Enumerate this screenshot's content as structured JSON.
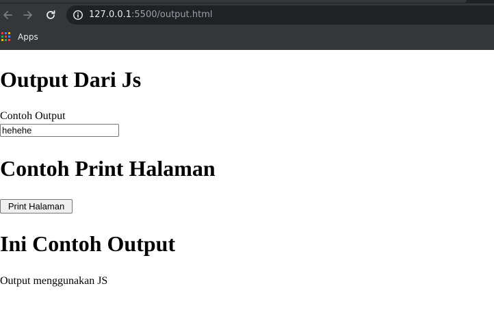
{
  "browser": {
    "url_host": "127.0.0.1",
    "url_path": ":5500/output.html",
    "bookmarks": [
      {
        "label": "Apps",
        "icon": "apps-grid-icon"
      }
    ],
    "icons": {
      "back": "back-arrow-icon",
      "forward": "forward-arrow-icon",
      "reload": "reload-icon",
      "site_info": "info-icon"
    }
  },
  "page": {
    "heading_output": "Output Dari Js",
    "contoh_label": "Contoh Output",
    "contoh_input_value": "hehehe",
    "heading_print": "Contoh Print Halaman",
    "print_button_label": "Print Halaman",
    "heading_ini": "Ini Contoh Output",
    "paragraph": "Output menggunakan JS"
  },
  "colors": {
    "chrome_bg": "#35363a",
    "omnibox_bg": "#202124",
    "chrome_text": "#e8eaed",
    "chrome_muted": "#9aa0a6"
  }
}
